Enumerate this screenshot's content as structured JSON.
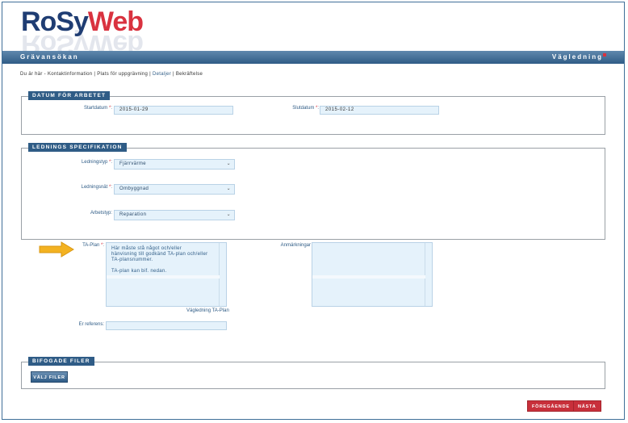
{
  "logo": {
    "ro": "Ro",
    "sy": "Sy",
    "web": "Web"
  },
  "header": {
    "title": "Grävansökan",
    "help": "Vägledning"
  },
  "breadcrumb": {
    "prefix": "Du är här - ",
    "s1": "Kontaktinformation",
    "sep": " | ",
    "s2": "Plats för uppgrävning",
    "s3": "Detaljer",
    "s4": "Bekräftelse"
  },
  "datum": {
    "legend": "DATUM FÖR ARBETET",
    "start_label": "Startdatum",
    "start_value": "2015-01-29",
    "slut_label": "Slutdatum",
    "slut_value": "2015-02-12"
  },
  "ledning": {
    "legend": "LEDNINGS SPECIFIKATION",
    "typ_label": "Ledningstyp",
    "typ_value": "Fjärrvärme",
    "nat_label": "Ledningsnät",
    "nat_value": "Ombyggnad",
    "arb_label": "Arbetstyp:",
    "arb_value": "Reparation"
  },
  "taplan": {
    "label": "TA-Plan",
    "text1": "Här måste stå något och/eller hänvisning till godkänd TA-plan och/eller TA-plansnummer.",
    "text2": "TA-plan kan bif. nedan.",
    "link": "Vägledning TA-Plan"
  },
  "anmarkningar": {
    "label": "Anmärkningar"
  },
  "referens": {
    "label": "Er referens:",
    "value": ""
  },
  "files": {
    "legend": "BIFOGADE FILER",
    "button": "VÄLJ FILER"
  },
  "nav": {
    "prev": "FÖREGÅENDE",
    "next": "NÄSTA"
  },
  "required_mark": "*",
  "colors": {
    "accent": "#2f5c86",
    "danger": "#c8303b",
    "field": "#e5f2fb"
  }
}
